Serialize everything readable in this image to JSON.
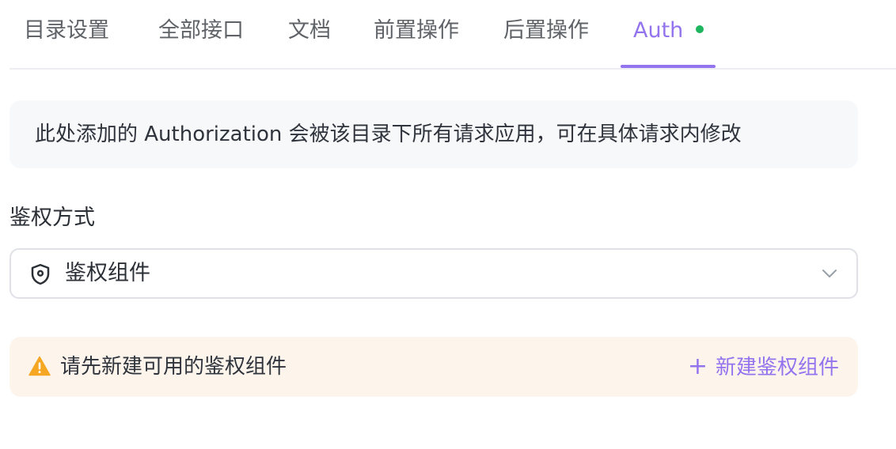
{
  "tabs": [
    {
      "label": "目录设置"
    },
    {
      "label": "全部接口"
    },
    {
      "label": "文档"
    },
    {
      "label": "前置操作"
    },
    {
      "label": "后置操作"
    },
    {
      "label": "Auth"
    }
  ],
  "active_tab": "Auth",
  "info": {
    "text": "此处添加的 Authorization 会被该目录下所有请求应用，可在具体请求内修改"
  },
  "auth": {
    "label": "鉴权方式",
    "selected": "鉴权组件"
  },
  "warning": {
    "text": "请先新建可用的鉴权组件",
    "create_plus": "+",
    "create_label": "新建鉴权组件"
  },
  "icons": {
    "select_icon": "shield-icon",
    "dropdown_icon": "chevron-down-icon",
    "warning_icon": "warning-triangle-icon",
    "status_dot": "green-status-dot"
  },
  "colors": {
    "accent": "#9373ee",
    "status_dot": "#1fb55e",
    "warning": "#f5a623",
    "warning_bg": "#fdf5ec",
    "info_bg": "#f7f8fa"
  }
}
